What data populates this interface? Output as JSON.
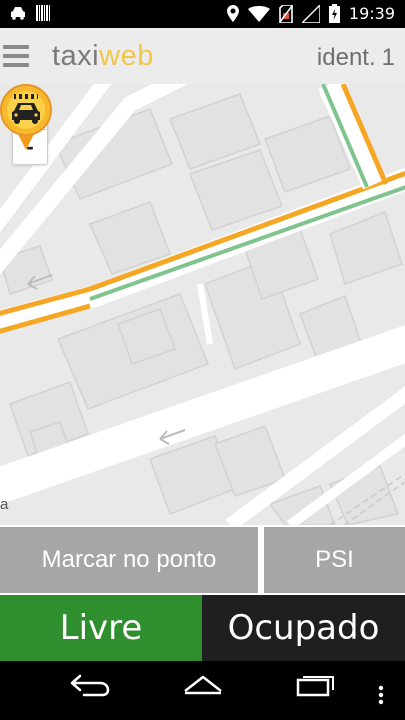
{
  "status_bar": {
    "time": "19:39",
    "left_icons": [
      "taxi-notification-icon",
      "barcode-notification-icon"
    ],
    "right_icons": [
      "location-icon",
      "wifi-icon",
      "no-sim-icon",
      "signal-icon",
      "battery-charging-icon"
    ]
  },
  "header": {
    "brand_part1": "taxi",
    "brand_part2": "web",
    "ident_label": "ident.",
    "ident_value": "1"
  },
  "map": {
    "zoom_in": "+",
    "zoom_out": "-",
    "street_label": "a"
  },
  "actions": {
    "marcar_label": "Marcar no ponto",
    "psi_label": "PSI"
  },
  "status": {
    "livre_label": "Livre",
    "ocupado_label": "Ocupado"
  },
  "colors": {
    "livre_green": "#2f8e2d",
    "ocupado_dark": "#1f1f1f",
    "action_gray": "#a6a6a6",
    "brand_yellow": "#f0c74a",
    "road_orange": "#f5a623",
    "road_green": "#7fc38d"
  }
}
